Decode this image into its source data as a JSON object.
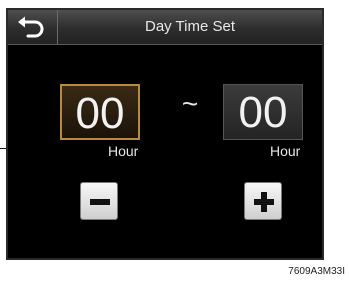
{
  "header": {
    "title": "Day Time Set",
    "back_icon": "back-arrow-icon"
  },
  "time_range": {
    "from": {
      "value": "00",
      "unit": "Hour",
      "selected": true
    },
    "separator": "~",
    "to": {
      "value": "00",
      "unit": "Hour",
      "selected": false
    }
  },
  "controls": {
    "decrement_icon": "minus-icon",
    "increment_icon": "plus-icon"
  },
  "figure_code": "7609A3M33I",
  "colors": {
    "screen_background": "#000000",
    "selected_border": "#b88a3c",
    "text": "#f2f2f2"
  }
}
